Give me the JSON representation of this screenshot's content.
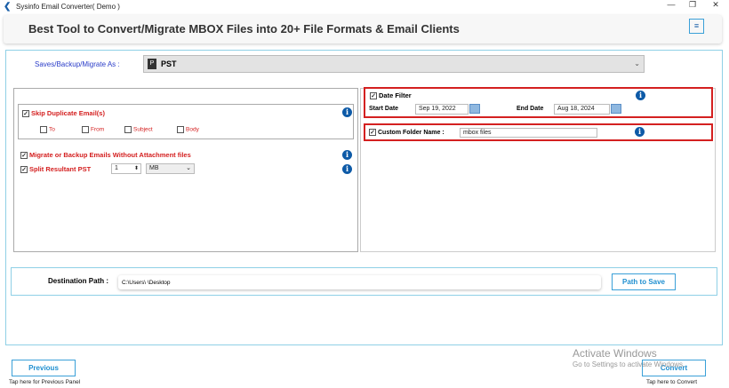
{
  "window": {
    "title": "Sysinfo Email Converter( Demo )"
  },
  "header": {
    "title": "Best Tool to Convert/Migrate MBOX Files into 20+ File Formats & Email Clients",
    "menu_icon": "hamburger-icon"
  },
  "save_as": {
    "label": "Saves/Backup/Migrate As :",
    "value": "PST"
  },
  "options": {
    "skip_duplicate": {
      "label": "Skip Duplicate Email(s)",
      "checked": true
    },
    "fields": [
      {
        "label": "To",
        "checked": false
      },
      {
        "label": "From",
        "checked": false
      },
      {
        "label": "Subject",
        "checked": false
      },
      {
        "label": "Body",
        "checked": false
      }
    ],
    "no_attachment": {
      "label": "Migrate or Backup Emails Without Attachment files",
      "checked": true
    },
    "split": {
      "label": "Split Resultant PST",
      "checked": true,
      "value": "1",
      "unit": "MB"
    }
  },
  "date_filter": {
    "label": "Date Filter",
    "checked": true,
    "start_label": "Start Date",
    "start": "Sep 19, 2022",
    "end_label": "End Date",
    "end": "Aug 18, 2024"
  },
  "custom_folder": {
    "label": "Custom Folder Name :",
    "checked": true,
    "value": "mbox files"
  },
  "destination": {
    "label": "Destination Path :",
    "value": "C:\\Users\\      \\Desktop",
    "button": "Path to Save"
  },
  "footer": {
    "previous": "Previous",
    "previous_hint": "Tap here for Previous Panel",
    "convert": "Convert",
    "convert_hint": "Tap here to Convert"
  },
  "watermark": {
    "title": "Activate Windows",
    "subtitle": "Go to Settings to activate Windows."
  }
}
